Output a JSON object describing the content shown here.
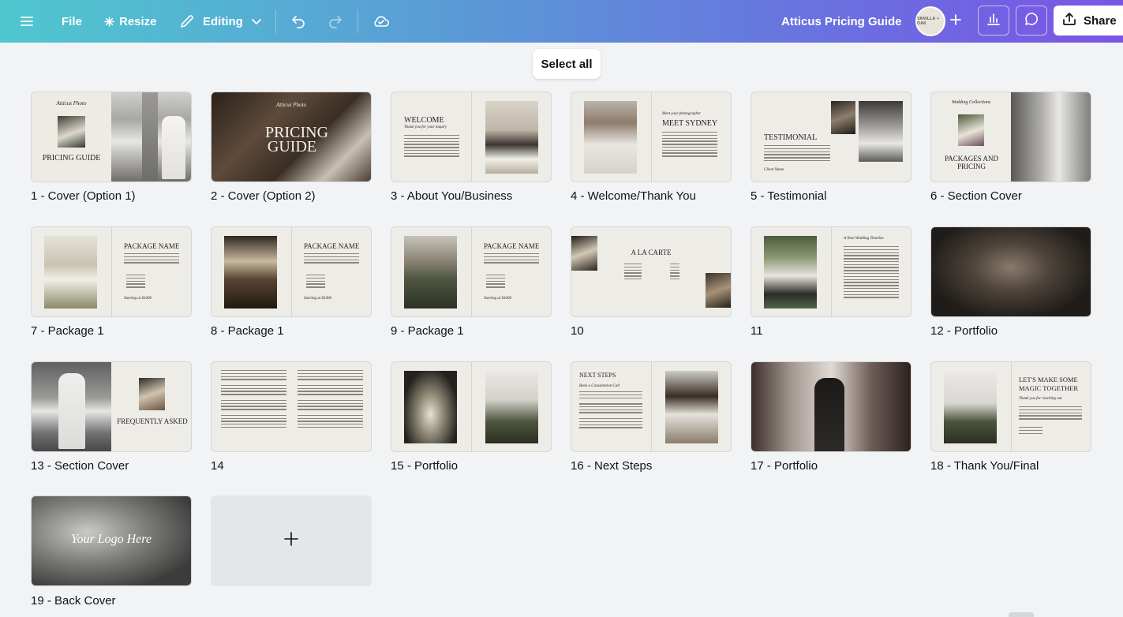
{
  "topbar": {
    "menu_icon": "hamburger-icon",
    "file_label": "File",
    "resize_label": "Resize",
    "editing_label": "Editing",
    "document_title": "Atticus Pricing Guide",
    "avatar_text": "VANILLA + OAK",
    "share_label": "Share",
    "icons": [
      "crown-icon",
      "pencil-icon",
      "chevron-down-icon",
      "undo-icon",
      "redo-icon",
      "cloud-check-icon",
      "plus-icon",
      "bar-chart-icon",
      "comment-icon",
      "share-upload-icon"
    ],
    "gradient_colors": [
      "#4fc7cf",
      "#5a9bd6",
      "#6a6fe0",
      "#7b55e4"
    ]
  },
  "toolbar": {
    "select_all_label": "Select all"
  },
  "pages": [
    {
      "label": "1 - Cover (Option 1)",
      "title": "PRICING GUIDE",
      "script": "Atticus Photo"
    },
    {
      "label": "2 - Cover (Option 2)",
      "title": "PRICING GUIDE",
      "script": "Atticus Photo"
    },
    {
      "label": "3 - About You/Business",
      "title": "WELCOME",
      "script": "Thank you for your inquiry"
    },
    {
      "label": "4 - Welcome/Thank You",
      "title": "MEET SYDNEY",
      "script": "Meet your photographer"
    },
    {
      "label": "5 - Testimonial",
      "title": "TESTIMONIAL",
      "script": "Client Name"
    },
    {
      "label": "6 - Section Cover",
      "title": "PACKAGES AND PRICING",
      "script": "Wedding Collections"
    },
    {
      "label": "7 - Package 1",
      "title": "PACKAGE NAME",
      "script": "Starting at $1000"
    },
    {
      "label": "8 - Package 1",
      "title": "PACKAGE NAME",
      "script": "Starting at $1000"
    },
    {
      "label": "9 - Package 1",
      "title": "PACKAGE NAME",
      "script": "Starting at $1000"
    },
    {
      "label": "10",
      "title": "A LA CARTE",
      "script": ""
    },
    {
      "label": "11",
      "title": "",
      "script": "A Note Wedding Timeline"
    },
    {
      "label": "12 - Portfolio",
      "title": "",
      "script": ""
    },
    {
      "label": "13 - Section Cover",
      "title": "FREQUENTLY ASKED",
      "script": ""
    },
    {
      "label": "14",
      "title": "",
      "script": ""
    },
    {
      "label": "15 - Portfolio",
      "title": "",
      "script": ""
    },
    {
      "label": "16 - Next Steps",
      "title": "NEXT STEPS",
      "script": "Book a Consultation Call"
    },
    {
      "label": "17 - Portfolio",
      "title": "",
      "script": ""
    },
    {
      "label": "18 - Thank You/Final",
      "title": "LET'S MAKE SOME MAGIC TOGETHER",
      "script": "Thank you for reaching out"
    },
    {
      "label": "19 - Back Cover",
      "title": "",
      "script": "Your Logo Here"
    }
  ],
  "add_page_icon": "plus-icon"
}
